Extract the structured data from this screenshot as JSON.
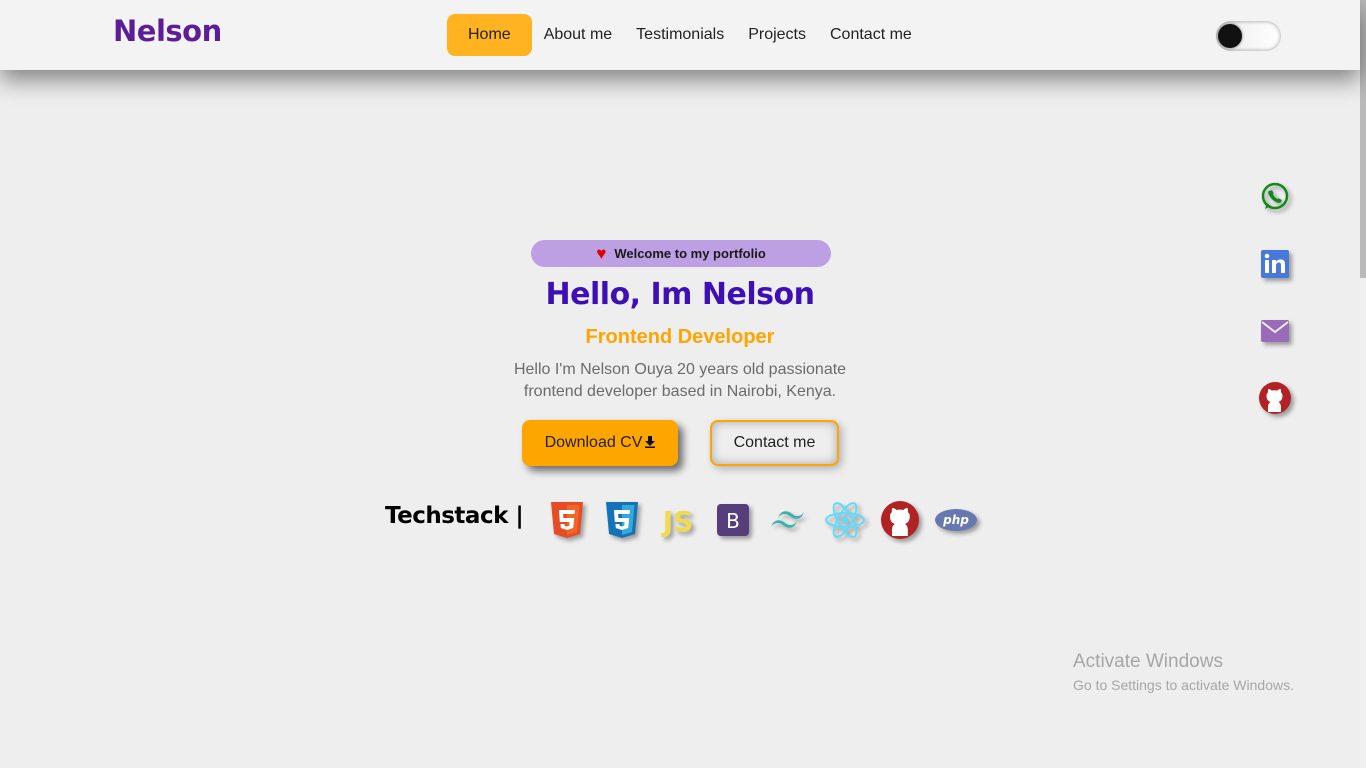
{
  "header": {
    "logo": "Nelson",
    "nav": [
      "Home",
      "About me",
      "Testimonials",
      "Projects",
      "Contact me"
    ],
    "active_nav": "Home",
    "theme_toggle_icon": "dark-mode-toggle"
  },
  "hero": {
    "badge": "Welcome to my portfolio",
    "badge_icon": "heart-icon",
    "title": "Hello, Im Nelson",
    "role": "Frontend Developer",
    "description": "Hello I'm Nelson Ouya 20 years old passionate frontend developer based in Nairobi, Kenya.",
    "download_cv": "Download CV",
    "contact": "Contact me"
  },
  "techstack": {
    "label": "Techstack |",
    "icons": [
      "html5-icon",
      "css3-icon",
      "javascript-icon",
      "bootstrap-icon",
      "tailwind-icon",
      "react-icon",
      "github-icon",
      "php-icon"
    ]
  },
  "socials": [
    "whatsapp-icon",
    "linkedin-icon",
    "email-icon",
    "github-icon"
  ],
  "watermark": {
    "title": "Activate Windows",
    "subtitle": "Go to Settings to activate Windows."
  },
  "colors": {
    "accent": "#ffa500",
    "logo": "#5b1e98",
    "title": "#3d0fb5",
    "badge": "#bda0e3",
    "background": "#eeeeee"
  }
}
